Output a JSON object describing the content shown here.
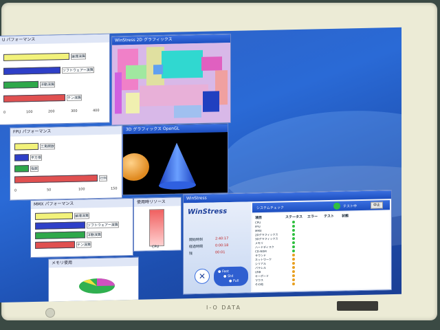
{
  "monitor": {
    "brand": "I-O DATA"
  },
  "windows": {
    "cpu": {
      "title": "U パフォーマンス",
      "ticks": [
        "0",
        "100",
        "200",
        "300",
        "400"
      ],
      "bars": [
        {
          "label": "論理演算",
          "value": 290,
          "color": "#f2f27a"
        },
        {
          "label": "ソフトウェアー演算",
          "value": 250,
          "color": "#2e3fc8"
        },
        {
          "label": "浮動演算",
          "value": 150,
          "color": "#2ea84a"
        },
        {
          "label": "テン演算",
          "value": 270,
          "color": "#e05050"
        }
      ]
    },
    "fpu": {
      "title": "FPU パフォーマンス",
      "ticks": [
        "0",
        "50",
        "100",
        "150"
      ],
      "bars": [
        {
          "label": "三角関数",
          "value": 35,
          "color": "#f2f27a"
        },
        {
          "label": "平方根",
          "value": 20,
          "color": "#2e3fc8"
        },
        {
          "label": "指数",
          "value": 20,
          "color": "#2ea84a"
        },
        {
          "label": "行列",
          "value": 128,
          "color": "#e05050"
        }
      ]
    },
    "mmx": {
      "title": "MMX パフォーマンス",
      "bars": [
        {
          "label": "論理演算",
          "value": 70,
          "color": "#f2f27a"
        },
        {
          "label": "ソフトウェアー演算",
          "value": 95,
          "color": "#2e3fc8"
        },
        {
          "label": "浮動演算",
          "value": 95,
          "color": "#2ea84a"
        },
        {
          "label": "テン演算",
          "value": 75,
          "color": "#e05050"
        }
      ]
    },
    "g2d": {
      "title": "WinStress 2D グラフィックス"
    },
    "g3d": {
      "title": "3D グラフィックス OpenGL"
    },
    "usage": {
      "title": "使用時リソース",
      "label": "CPU"
    },
    "memory": {
      "title": "メモリ使用"
    },
    "main": {
      "title": "WinStress",
      "logo": "WinStress",
      "header": "システムチェック",
      "status": "テスト中",
      "stop_button": "中止",
      "options": [
        "Fast",
        "Std",
        "Full"
      ],
      "info_rows": [
        {
          "k": "開始時刻",
          "v": "2:40:17"
        },
        {
          "k": "経過時間",
          "v": "0:00:18"
        },
        {
          "k": "残",
          "v": "00:01"
        }
      ],
      "columns": [
        "項目",
        "ステータス",
        "エラー",
        "テスト",
        "状態"
      ],
      "rows": [
        "CPU",
        "FPU",
        "MMX",
        "2Dグラフィックス",
        "3Dグラフィックス",
        "メモリ",
        "ハードディスク",
        "CD-ROM",
        "サウンド",
        "ネットワーク",
        "シリアル",
        "パラレル",
        "USB",
        "キーボード",
        "マウス",
        "その他"
      ]
    }
  }
}
